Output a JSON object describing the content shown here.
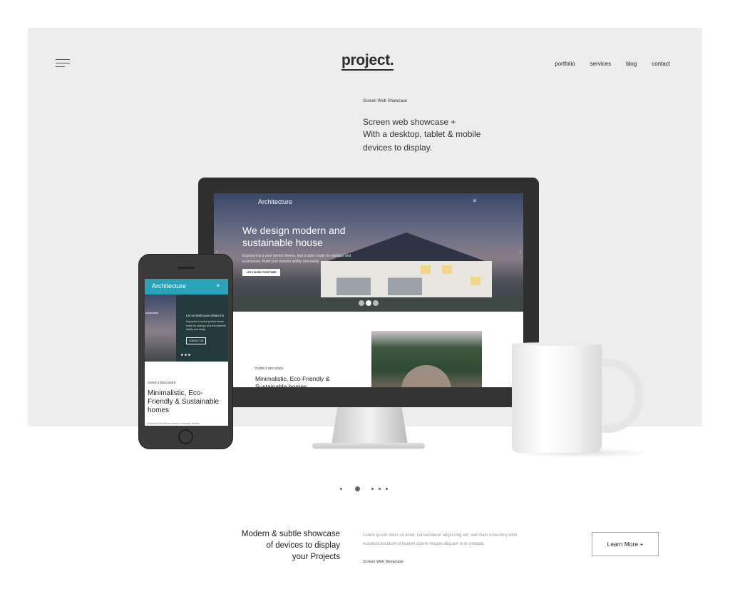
{
  "brand": {
    "logo": "project."
  },
  "nav": {
    "items": [
      "portfolio",
      "services",
      "blog",
      "contact"
    ]
  },
  "hero": {
    "kicker": "Screen Web Showcase",
    "headline_lines": [
      "Screen web showcase +",
      "With a desktop, tablet & mobile",
      "devices to display."
    ]
  },
  "desktop_mockup": {
    "site_title": "Architecture",
    "menu_glyph": "≡",
    "headline": "We design modern and sustainable house",
    "subtext": "Exponent is a pixel perfect theme, that is tailor made for startups and businesses. Build your website swiftly and easily.",
    "cta": "LETS WORK TOGETHER",
    "prev_arrow": "‹",
    "next_arrow": "›",
    "content_kicker": "OVER 2 DECADES",
    "content_title": "Minimalistic, Eco-Friendly & Sustainable homes"
  },
  "phone_mockup": {
    "site_title": "Architecture",
    "menu_glyph": "≡",
    "side_label": "ustainable",
    "banner_title": "Let us build your dream ho",
    "banner_text": "Exponent is a pixel perfect theme made for startups and busi website swiftly and easily.",
    "cta": "CONTACT US",
    "content_kicker": "OVER 2 DECADES",
    "content_title": "Minimalistic, Eco-Friendly & Sustainable homes",
    "footer_text": "Exponent WordPress theme is insanely flexible"
  },
  "carousel": {
    "count": 5,
    "active_index": 1
  },
  "bottom": {
    "title_lines": [
      "Modern & subtle showcase",
      "of devices to display",
      "your Projects"
    ],
    "body": "Lorem ipsum dolor sit amet, consectetuer adipiscing elit, sed diam nonummy nibh euismod tincidunt ut laoreet dolore magna aliquam erat volutpat.",
    "kicker": "Screen Web Showcase",
    "button": "Learn More +"
  },
  "colors": {
    "panel": "#ededed",
    "phone_accent": "#2aa3b8",
    "device_frame": "#2f2f2f"
  }
}
